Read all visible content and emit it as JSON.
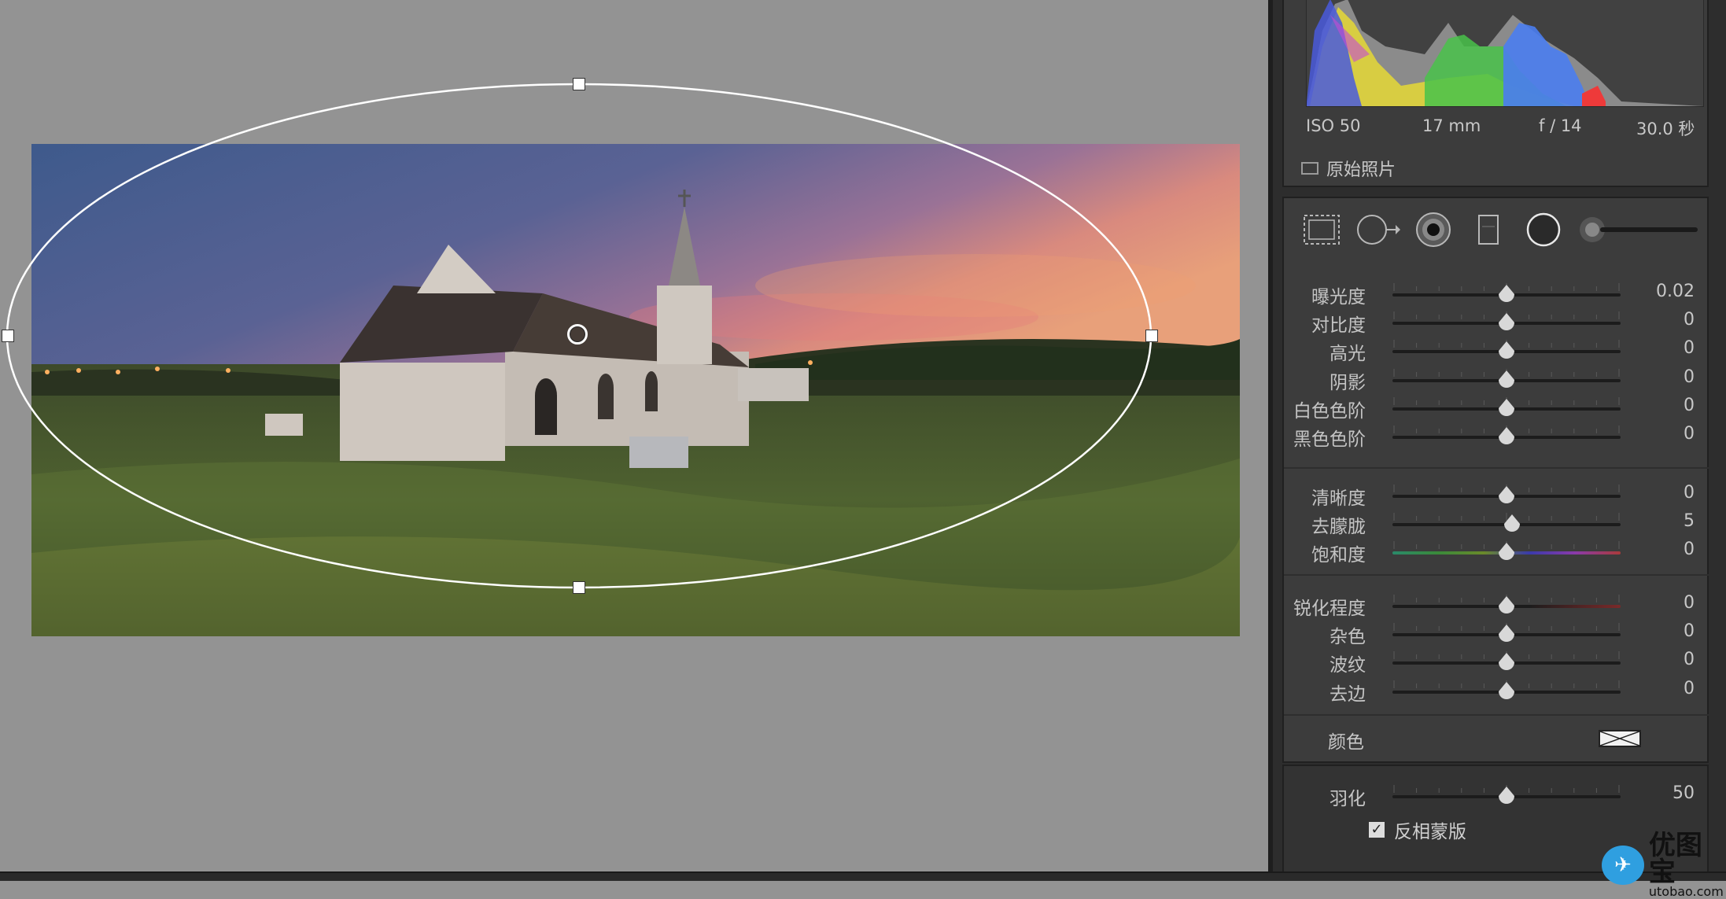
{
  "histogram_info": {
    "iso": "ISO 50",
    "focal": "17 mm",
    "aperture": "f / 14",
    "shutter": "30.0 秒"
  },
  "original_photo_label": "原始照片",
  "tools": [
    "crop-overlay",
    "spot-removal",
    "red-eye",
    "graduated-filter",
    "radial-filter",
    "adjustment-brush"
  ],
  "adjustments": {
    "group1": [
      {
        "label": "曝光度",
        "value": "0.02",
        "pos": 0.5
      },
      {
        "label": "对比度",
        "value": "0",
        "pos": 0.5
      },
      {
        "label": "高光",
        "value": "0",
        "pos": 0.5
      },
      {
        "label": "阴影",
        "value": "0",
        "pos": 0.5
      },
      {
        "label": "白色色阶",
        "value": "0",
        "pos": 0.5
      },
      {
        "label": "黑色色阶",
        "value": "0",
        "pos": 0.5
      }
    ],
    "group2": [
      {
        "label": "清晰度",
        "value": "0",
        "pos": 0.5
      },
      {
        "label": "去朦胧",
        "value": "5",
        "pos": 0.525
      },
      {
        "label": "饱和度",
        "value": "0",
        "pos": 0.5
      }
    ],
    "group3": [
      {
        "label": "锐化程度",
        "value": "0",
        "pos": 0.5
      },
      {
        "label": "杂色",
        "value": "0",
        "pos": 0.5
      },
      {
        "label": "波纹",
        "value": "0",
        "pos": 0.5
      },
      {
        "label": "去边",
        "value": "0",
        "pos": 0.5
      }
    ]
  },
  "color_label": "颜色",
  "feather": {
    "label": "羽化",
    "value": "50",
    "pos": 0.5
  },
  "invert_mask": {
    "label": "反相蒙版",
    "checked": true
  },
  "watermark": {
    "title": "优图宝",
    "url": "utobao.com"
  }
}
